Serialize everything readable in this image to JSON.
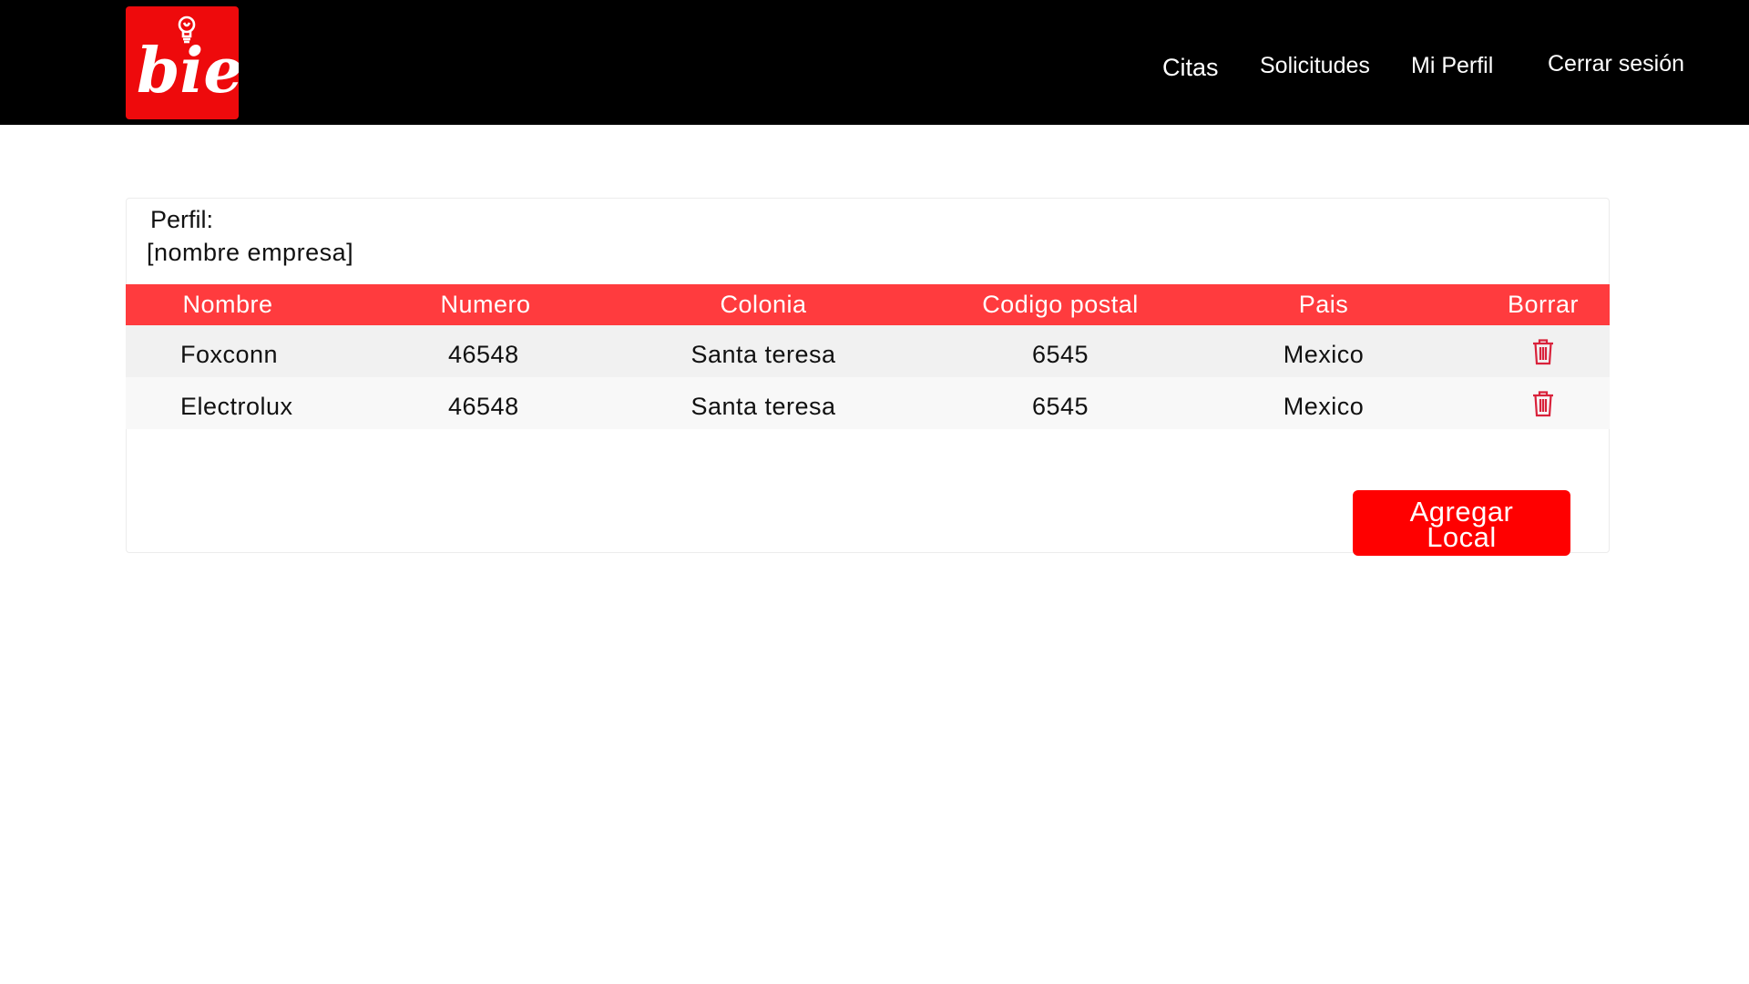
{
  "header": {
    "logo_text": "bie",
    "nav": {
      "citas": "Citas",
      "solicitudes": "Solicitudes",
      "mi_perfil": "Mi Perfil",
      "cerrar_sesion": "Cerrar sesión"
    }
  },
  "profile": {
    "label": "Perfil:",
    "company": "[nombre empresa]"
  },
  "table": {
    "headers": [
      "Nombre",
      "Numero",
      "Colonia",
      "Codigo postal",
      "Pais",
      "Borrar"
    ],
    "rows": [
      {
        "nombre": "Foxconn",
        "numero": "46548",
        "colonia": "Santa teresa",
        "codigo_postal": "6545",
        "pais": "Mexico",
        "action_icon": "trash-icon"
      },
      {
        "nombre": "Electrolux",
        "numero": "46548",
        "colonia": "Santa teresa",
        "codigo_postal": "6545",
        "pais": "Mexico",
        "action_icon": "trash-icon"
      }
    ]
  },
  "actions": {
    "agregar_line1": "Agregar",
    "agregar_line2": "Local"
  },
  "colors": {
    "brand_red": "#ee0a0c",
    "header_bg": "#000000",
    "table_header": "#ff3b3e",
    "trash_icon": "#d9223b",
    "button": "#ff0000"
  }
}
